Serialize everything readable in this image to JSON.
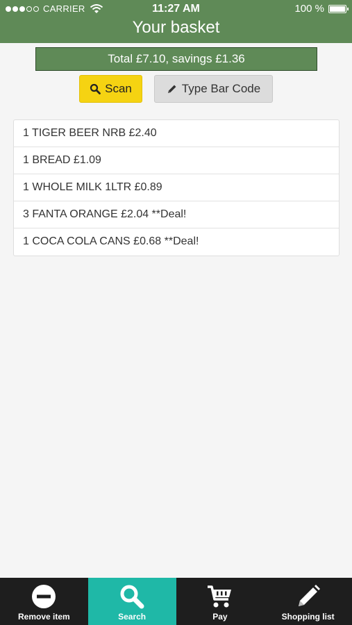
{
  "status_bar": {
    "carrier": "CARRIER",
    "time": "11:27 AM",
    "battery": "100 %"
  },
  "header": {
    "title": "Your basket"
  },
  "summary": {
    "total_text": "Total £7.10, savings £1.36"
  },
  "actions": {
    "scan_label": "Scan",
    "type_barcode_label": "Type Bar Code"
  },
  "basket": {
    "items": [
      "1 TIGER BEER NRB £2.40",
      "1 BREAD £1.09",
      "1 WHOLE MILK 1LTR £0.89",
      "3 FANTA ORANGE £2.04 **Deal!",
      "1 COCA COLA CANS £0.68 **Deal!"
    ]
  },
  "tabbar": {
    "tabs": [
      {
        "label": "Remove item",
        "icon": "minus-circle-icon"
      },
      {
        "label": "Search",
        "icon": "search-icon",
        "active": true
      },
      {
        "label": "Pay",
        "icon": "cart-icon"
      },
      {
        "label": "Shopping list",
        "icon": "pencil-icon"
      }
    ]
  },
  "colors": {
    "header_green": "#5f8a57",
    "scan_yellow": "#f5d312",
    "active_tab": "#1fb8a7",
    "tabbar_bg": "#1e1e1e"
  }
}
